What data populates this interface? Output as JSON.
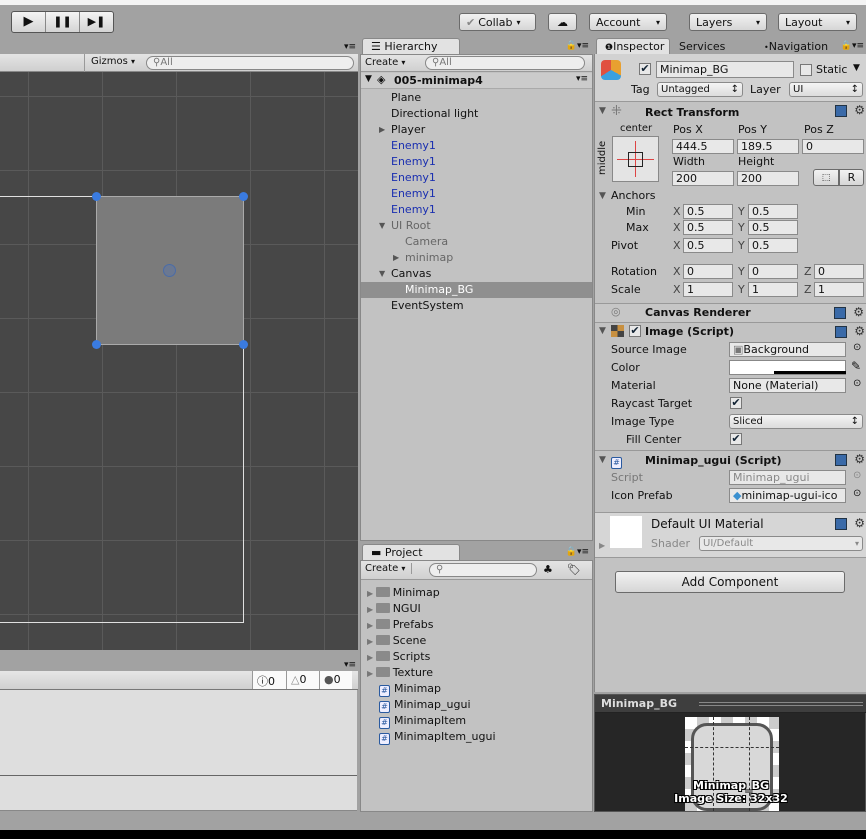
{
  "toolbar": {
    "play": "▶",
    "pause": "❚❚",
    "step": "▶❚",
    "collab": "Collab",
    "account": "Account",
    "layers": "Layers",
    "layout": "Layout"
  },
  "scene": {
    "gizmos": "Gizmos",
    "search_placeholder": "All"
  },
  "hierarchy": {
    "tab": "Hierarchy",
    "create": "Create",
    "search_placeholder": "All",
    "scene_name": "005-minimap4",
    "items": [
      {
        "label": "Plane",
        "depth": 0,
        "style": "normal",
        "arrow": false
      },
      {
        "label": "Directional light",
        "depth": 0,
        "style": "normal",
        "arrow": false
      },
      {
        "label": "Player",
        "depth": 0,
        "style": "normal",
        "arrow": true
      },
      {
        "label": "Enemy1",
        "depth": 0,
        "style": "prefab",
        "arrow": false
      },
      {
        "label": "Enemy1",
        "depth": 0,
        "style": "prefab",
        "arrow": false
      },
      {
        "label": "Enemy1",
        "depth": 0,
        "style": "prefab",
        "arrow": false
      },
      {
        "label": "Enemy1",
        "depth": 0,
        "style": "prefab",
        "arrow": false
      },
      {
        "label": "Enemy1",
        "depth": 0,
        "style": "prefab",
        "arrow": false
      },
      {
        "label": "UI Root",
        "depth": 0,
        "style": "inactive",
        "arrow": true,
        "open": true
      },
      {
        "label": "Camera",
        "depth": 1,
        "style": "inactive",
        "arrow": false
      },
      {
        "label": "minimap",
        "depth": 1,
        "style": "inactive",
        "arrow": true
      },
      {
        "label": "Canvas",
        "depth": 0,
        "style": "normal",
        "arrow": true,
        "open": true
      },
      {
        "label": "Minimap_BG",
        "depth": 1,
        "style": "selected",
        "arrow": false
      },
      {
        "label": "EventSystem",
        "depth": 0,
        "style": "normal",
        "arrow": false
      }
    ]
  },
  "project": {
    "tab": "Project",
    "create": "Create",
    "folders": [
      "Minimap",
      "NGUI",
      "Prefabs",
      "Scene",
      "Scripts",
      "Texture"
    ],
    "scripts": [
      "Minimap",
      "Minimap_ugui",
      "MinimapItem",
      "MinimapItem_ugui"
    ]
  },
  "console": {
    "info_count": "0",
    "warning_count": "0",
    "error_count": "0"
  },
  "inspector": {
    "tabs": [
      "Inspector",
      "Services",
      "Navigation"
    ],
    "object_name": "Minimap_BG",
    "static_label": "Static",
    "tag_label": "Tag",
    "tag_value": "Untagged",
    "layer_label": "Layer",
    "layer_value": "UI",
    "rect_transform": {
      "title": "Rect Transform",
      "anchor_h": "center",
      "anchor_v": "middle",
      "pos_x_label": "Pos X",
      "pos_y_label": "Pos Y",
      "pos_z_label": "Pos Z",
      "pos_x": "444.5",
      "pos_y": "189.5",
      "pos_z": "0",
      "width_label": "Width",
      "height_label": "Height",
      "width": "200",
      "height": "200",
      "r_button": "R",
      "anchors_label": "Anchors",
      "min_label": "Min",
      "max_label": "Max",
      "pivot_label": "Pivot",
      "min_x": "0.5",
      "min_y": "0.5",
      "max_x": "0.5",
      "max_y": "0.5",
      "pivot_x": "0.5",
      "pivot_y": "0.5",
      "rotation_label": "Rotation",
      "scale_label": "Scale",
      "rot_x": "0",
      "rot_y": "0",
      "rot_z": "0",
      "scale_x": "1",
      "scale_y": "1",
      "scale_z": "1",
      "x": "X",
      "y": "Y",
      "z": "Z"
    },
    "canvas_renderer": {
      "title": "Canvas Renderer"
    },
    "image": {
      "title": "Image (Script)",
      "source_image_label": "Source Image",
      "source_image": "Background",
      "color_label": "Color",
      "color_value": "#ffffff",
      "material_label": "Material",
      "material": "None (Material)",
      "raycast_label": "Raycast Target",
      "raycast": true,
      "image_type_label": "Image Type",
      "image_type": "Sliced",
      "fill_center_label": "Fill Center",
      "fill_center": true
    },
    "minimap_ugui": {
      "title": "Minimap_ugui (Script)",
      "script_label": "Script",
      "script": "Minimap_ugui",
      "icon_prefab_label": "Icon Prefab",
      "icon_prefab": "minimap-ugui-ico"
    },
    "material": {
      "name": "Default UI Material",
      "shader_label": "Shader",
      "shader": "UI/Default"
    },
    "add_component": "Add Component"
  },
  "preview": {
    "title": "Minimap_BG",
    "caption_name": "Minimap_BG",
    "caption_size": "Image Size: 32x32"
  },
  "colors": {
    "scene_bg": "#474747",
    "selection": "#8f8f8f",
    "prefab_text": "#1a2fb0",
    "handle": "#3a7be0"
  }
}
